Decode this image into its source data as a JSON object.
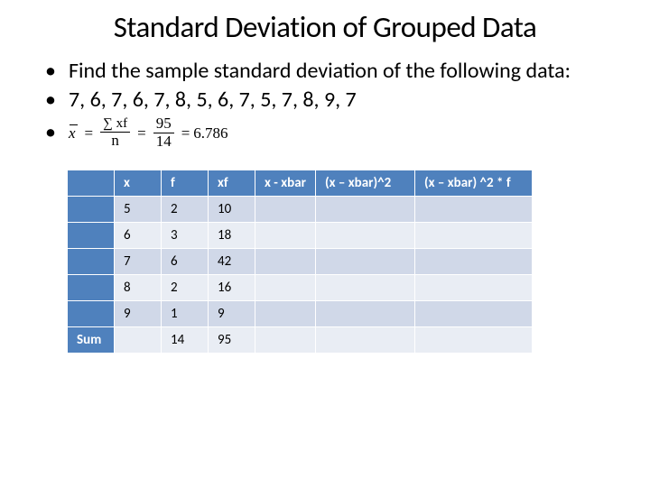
{
  "title": "Standard Deviation of Grouped Data",
  "bullets": {
    "b1": "Find the sample standard deviation of the following data:",
    "b2": "7, 6, 7, 6, 7, 8, 5, 6, 7, 5, 7, 8, 9, 7"
  },
  "formula": {
    "lhs": "x",
    "num1": "∑ xf",
    "den1": "n",
    "num2": "95",
    "den2": "14",
    "result": "6.786"
  },
  "table": {
    "headers": [
      "x",
      "f",
      "xf",
      "x - xbar",
      "(x – xbar)^2",
      "(x – xbar) ^2 * f"
    ],
    "rows": [
      {
        "x": "5",
        "f": "2",
        "xf": "10"
      },
      {
        "x": "6",
        "f": "3",
        "xf": "18"
      },
      {
        "x": "7",
        "f": "6",
        "xf": "42"
      },
      {
        "x": "8",
        "f": "2",
        "xf": "16"
      },
      {
        "x": "9",
        "f": "1",
        "xf": "9"
      }
    ],
    "sum_label": "Sum",
    "sum_f": "14",
    "sum_xf": "95"
  },
  "chart_data": {
    "type": "table",
    "title": "Standard Deviation of Grouped Data",
    "columns": [
      "x",
      "f",
      "xf",
      "x - xbar",
      "(x - xbar)^2",
      "(x - xbar)^2 * f"
    ],
    "rows": [
      [
        5,
        2,
        10,
        null,
        null,
        null
      ],
      [
        6,
        3,
        18,
        null,
        null,
        null
      ],
      [
        7,
        6,
        42,
        null,
        null,
        null
      ],
      [
        8,
        2,
        16,
        null,
        null,
        null
      ],
      [
        9,
        1,
        9,
        null,
        null,
        null
      ]
    ],
    "sum_row": [
      null,
      14,
      95,
      null,
      null,
      null
    ],
    "mean": 6.786,
    "raw_data": [
      7,
      6,
      7,
      6,
      7,
      8,
      5,
      6,
      7,
      5,
      7,
      8,
      9,
      7
    ]
  }
}
